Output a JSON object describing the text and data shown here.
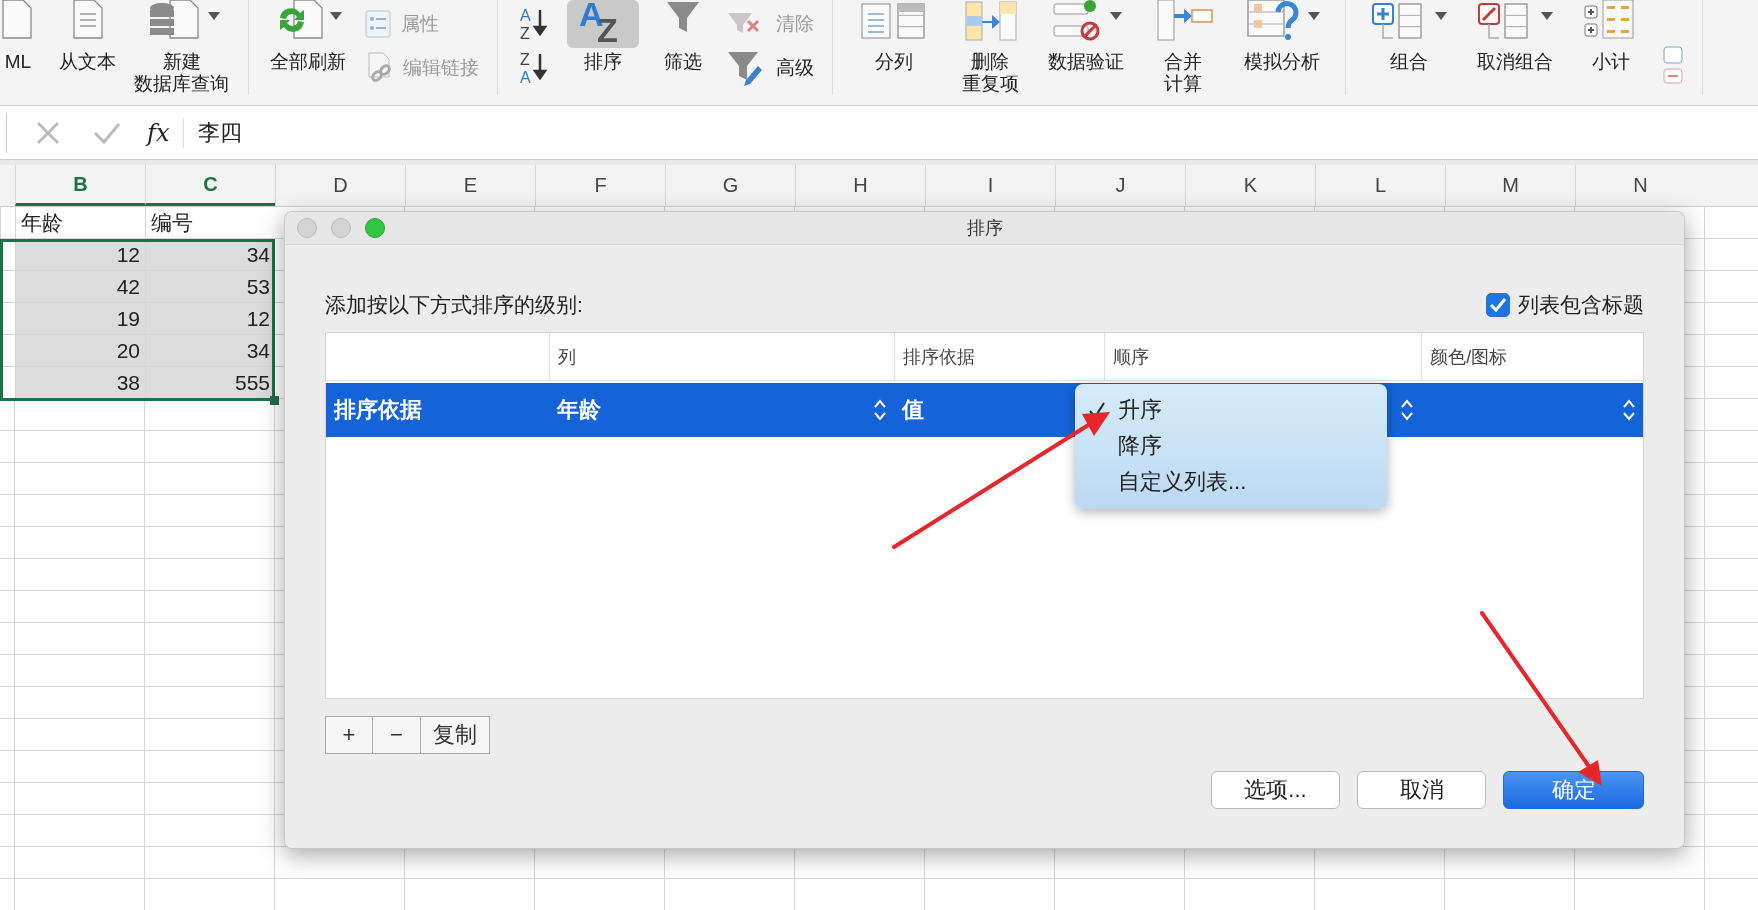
{
  "ribbon": {
    "groups": [
      {
        "items": [
          {
            "kind": "large",
            "label": "ML",
            "dropdown": false,
            "selected": false
          },
          {
            "kind": "large",
            "label": "从文本",
            "dropdown": false,
            "selected": false
          },
          {
            "kind": "large",
            "label": [
              "新建",
              "数据库查询"
            ],
            "dropdown": true,
            "selected": false
          }
        ]
      },
      {
        "items": [
          {
            "kind": "large",
            "label": "全部刷新",
            "dropdown": true,
            "selected": false
          },
          {
            "kind": "stack",
            "items": [
              {
                "label": "属性",
                "disabled": true
              },
              {
                "label": "编辑链接",
                "disabled": true
              }
            ]
          }
        ]
      },
      {
        "items": [
          {
            "kind": "stack",
            "items": [
              {
                "glyph": [
                  "A",
                  "Z"
                ]
              },
              {
                "glyph": [
                  "Z",
                  "A"
                ]
              }
            ]
          },
          {
            "kind": "large",
            "label": "排序",
            "glyph": [
              "A",
              "Z"
            ],
            "dropdown": false,
            "selected": true
          },
          {
            "kind": "large",
            "label": "筛选",
            "dropdown": false,
            "selected": false
          },
          {
            "kind": "stack",
            "items": [
              {
                "label": "清除",
                "disabled": true
              },
              {
                "label": "高级",
                "disabled": false
              }
            ]
          }
        ]
      },
      {
        "items": [
          {
            "kind": "large",
            "label": "分列",
            "dropdown": false,
            "selected": false
          },
          {
            "kind": "large",
            "label": [
              "删除",
              "重复项"
            ],
            "dropdown": false,
            "selected": false
          },
          {
            "kind": "large",
            "label": "数据验证",
            "dropdown": true,
            "selected": false
          },
          {
            "kind": "large",
            "label": [
              "合并",
              "计算"
            ],
            "dropdown": false,
            "selected": false
          },
          {
            "kind": "large",
            "label": "模拟分析",
            "dropdown": true,
            "selected": false
          }
        ]
      },
      {
        "items": [
          {
            "kind": "large",
            "label": "组合",
            "dropdown": true,
            "selected": false
          },
          {
            "kind": "large",
            "label": "取消组合",
            "dropdown": true,
            "selected": false
          },
          {
            "kind": "large",
            "label": "小计",
            "dropdown": false,
            "selected": false
          },
          {
            "kind": "icon"
          }
        ]
      }
    ]
  },
  "formula_bar": {
    "function_label": "fx",
    "value": "李四"
  },
  "sheet": {
    "columns": [
      {
        "label": "B",
        "selected": true
      },
      {
        "label": "C",
        "selected": true
      },
      {
        "label": "D",
        "selected": false
      },
      {
        "label": "E",
        "selected": false
      },
      {
        "label": "F",
        "selected": false
      },
      {
        "label": "G",
        "selected": false
      },
      {
        "label": "H",
        "selected": false
      },
      {
        "label": "I",
        "selected": false
      },
      {
        "label": "J",
        "selected": false
      },
      {
        "label": "K",
        "selected": false
      },
      {
        "label": "L",
        "selected": false
      },
      {
        "label": "M",
        "selected": false
      },
      {
        "label": "N",
        "selected": false
      }
    ],
    "rows": [
      {
        "kind": "text",
        "cells": [
          "年龄",
          "编号"
        ],
        "selected": false
      },
      {
        "kind": "number",
        "cells": [
          "12",
          "34"
        ],
        "selected": true
      },
      {
        "kind": "number",
        "cells": [
          "42",
          "53"
        ],
        "selected": true
      },
      {
        "kind": "number",
        "cells": [
          "19",
          "12"
        ],
        "selected": true
      },
      {
        "kind": "number",
        "cells": [
          "20",
          "34"
        ],
        "selected": true
      },
      {
        "kind": "number",
        "cells": [
          "38",
          "555"
        ],
        "selected": true
      }
    ]
  },
  "dialog": {
    "title": "排序",
    "prompt": "添加按以下方式排序的级别:",
    "header_checkbox": {
      "label": "列表包含标题",
      "checked": true
    },
    "columns": [
      "列",
      "排序依据",
      "顺序",
      "颜色/图标"
    ],
    "levels": [
      {
        "label": "排序依据",
        "column": "年龄",
        "sort_on": "值",
        "selected": true
      }
    ],
    "order_menu": [
      {
        "label": "升序",
        "checked": true
      },
      {
        "label": "降序",
        "checked": false
      },
      {
        "label": "自定义列表...",
        "checked": false
      }
    ],
    "level_buttons": [
      "+",
      "−",
      "复制"
    ],
    "buttons": [
      {
        "label": "选项...",
        "default": false
      },
      {
        "label": "取消",
        "default": false
      },
      {
        "label": "确定",
        "default": true
      }
    ]
  }
}
